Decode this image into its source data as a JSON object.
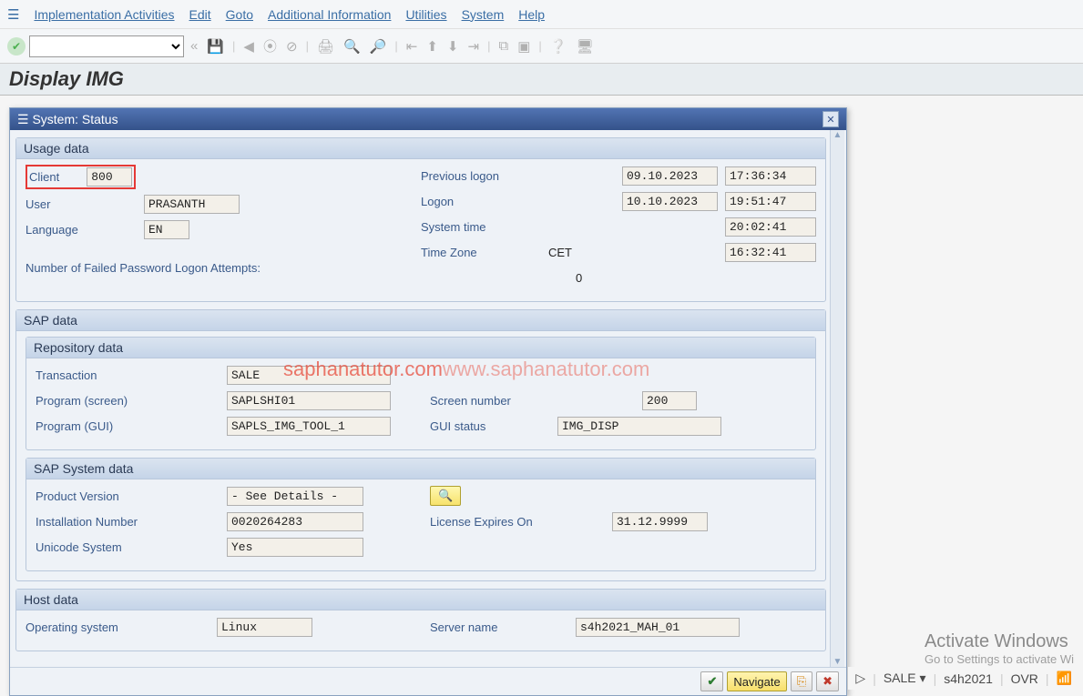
{
  "menu": {
    "items": [
      "Implementation Activities",
      "Edit",
      "Goto",
      "Additional Information",
      "Utilities",
      "System",
      "Help"
    ]
  },
  "page_title": "Display IMG",
  "dialog": {
    "title": "System: Status",
    "usage": {
      "header": "Usage data",
      "client_label": "Client",
      "client": "800",
      "user_label": "User",
      "user": "PRASANTH",
      "language_label": "Language",
      "language": "EN",
      "prev_logon_label": "Previous logon",
      "prev_logon_date": "09.10.2023",
      "prev_logon_time": "17:36:34",
      "logon_label": "Logon",
      "logon_date": "10.10.2023",
      "logon_time": "19:51:47",
      "sys_time_label": "System time",
      "sys_time": "20:02:41",
      "tz_label": "Time Zone",
      "tz": "CET",
      "tz_time": "16:32:41",
      "failed_label": "Number of Failed Password Logon Attempts:",
      "failed": "0"
    },
    "sap": {
      "header": "SAP data",
      "repo_header": "Repository data",
      "transaction_label": "Transaction",
      "transaction": "SALE",
      "prog_screen_label": "Program (screen)",
      "prog_screen": "SAPLSHI01",
      "prog_gui_label": "Program (GUI)",
      "prog_gui": "SAPLS_IMG_TOOL_1",
      "screen_no_label": "Screen number",
      "screen_no": "200",
      "gui_status_label": "GUI status",
      "gui_status": "IMG_DISP",
      "sys_header": "SAP System data",
      "product_label": "Product Version",
      "product": "- See Details -",
      "install_label": "Installation Number",
      "install": "0020264283",
      "unicode_label": "Unicode System",
      "unicode": "Yes",
      "license_label": "License Expires On",
      "license": "31.12.9999"
    },
    "host": {
      "header": "Host data",
      "os_label": "Operating system",
      "os": "Linux",
      "server_label": "Server name",
      "server": "s4h2021_MAH_01"
    },
    "footer": {
      "navigate": "Navigate"
    }
  },
  "watermark": {
    "a": "saphanatutor.com",
    "b": "www.saphanatutor.com"
  },
  "status": {
    "tcode": "SALE",
    "system": "s4h2021",
    "mode": "OVR"
  },
  "activate": {
    "big": "Activate Windows",
    "small": "Go to Settings to activate Wi"
  }
}
